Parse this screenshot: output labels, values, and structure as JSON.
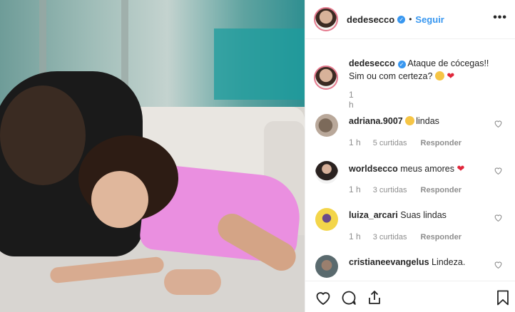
{
  "post": {
    "username": "dedesecco",
    "verified_icon": "verified-badge-icon",
    "separator": "•",
    "follow_label": "Seguir",
    "more_label": "•••",
    "accent_color": "#3897f0"
  },
  "caption": {
    "username": "dedesecco",
    "text_line1": "Ataque de cócegas!!",
    "text_line2": "Sim ou com certeza?",
    "time": "1 h"
  },
  "comments": [
    {
      "username": "adriana.9007",
      "text": "lindas",
      "time": "1 h",
      "likes": "5 curtidas",
      "reply": "Responder"
    },
    {
      "username": "worldsecco",
      "text": "meus amores",
      "time": "1 h",
      "likes": "3 curtidas",
      "reply": "Responder"
    },
    {
      "username": "luiza_arcari",
      "text": "Suas lindas",
      "time": "1 h",
      "likes": "3 curtidas",
      "reply": "Responder"
    },
    {
      "username": "cristianeevangelus",
      "text": "Lindeza.",
      "time": "",
      "likes": "",
      "reply": ""
    }
  ],
  "actions": [
    "heart-icon",
    "comment-icon",
    "share-icon",
    "bookmark-icon"
  ]
}
